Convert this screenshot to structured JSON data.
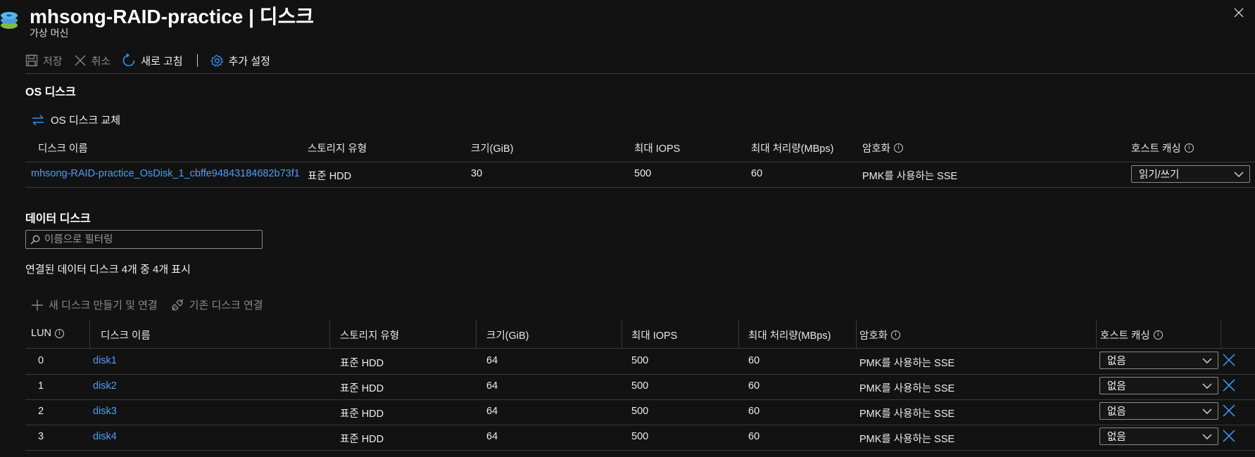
{
  "header": {
    "title": "mhsong-RAID-practice | 디스크",
    "subtitle": "가상 머신"
  },
  "toolbar": {
    "save_label": "저장",
    "discard_label": "취소",
    "refresh_label": "새로 고침",
    "settings_label": "추가 설정"
  },
  "os_disk": {
    "section_title": "OS 디스크",
    "swap_label": "OS 디스크 교체",
    "columns": {
      "name": "디스크 이름",
      "storage": "스토리지 유형",
      "size": "크기(GiB)",
      "iops": "최대 IOPS",
      "throughput": "최대 처리량(MBps)",
      "encryption": "암호화",
      "caching": "호스트 캐싱"
    },
    "row": {
      "name": "mhsong-RAID-practice_OsDisk_1_cbffe94843184682b73f1",
      "storage": "표준 HDD",
      "size": "30",
      "iops": "500",
      "throughput": "60",
      "encryption": "PMK를 사용하는 SSE",
      "caching": "읽기/쓰기"
    }
  },
  "data_disks": {
    "section_title": "데이터 디스크",
    "filter_placeholder": "이름으로 필터링",
    "count_text": "연결된 데이터 디스크 4개 중 4개 표시",
    "create_label": "새 디스크 만들기 및 연결",
    "attach_label": "기존 디스크 연결",
    "columns": {
      "lun": "LUN",
      "name": "디스크 이름",
      "storage": "스토리지 유형",
      "size": "크기(GiB)",
      "iops": "최대 IOPS",
      "throughput": "최대 처리량(MBps)",
      "encryption": "암호화",
      "caching": "호스트 캐싱"
    },
    "rows": [
      {
        "lun": "0",
        "name": "disk1",
        "storage": "표준 HDD",
        "size": "64",
        "iops": "500",
        "throughput": "60",
        "encryption": "PMK를 사용하는 SSE",
        "caching": "없음"
      },
      {
        "lun": "1",
        "name": "disk2",
        "storage": "표준 HDD",
        "size": "64",
        "iops": "500",
        "throughput": "60",
        "encryption": "PMK를 사용하는 SSE",
        "caching": "없음"
      },
      {
        "lun": "2",
        "name": "disk3",
        "storage": "표준 HDD",
        "size": "64",
        "iops": "500",
        "throughput": "60",
        "encryption": "PMK를 사용하는 SSE",
        "caching": "없음"
      },
      {
        "lun": "3",
        "name": "disk4",
        "storage": "표준 HDD",
        "size": "64",
        "iops": "500",
        "throughput": "60",
        "encryption": "PMK를 사용하는 SSE",
        "caching": "없음"
      }
    ]
  },
  "icons": {
    "header": "disk-stack-icon",
    "save": "save-icon",
    "discard": "close-icon",
    "refresh": "refresh-icon",
    "settings": "gear-icon",
    "swap": "swap-icon",
    "filter": "search-icon",
    "create": "plus-icon",
    "attach": "plug-icon",
    "delete": "delete-x-icon",
    "info": "info-icon",
    "dropdown": "chevron-down-icon"
  },
  "colors": {
    "background": "#121212",
    "link": "#4f9df7",
    "accent": "#3b8eea",
    "text": "#f2f2f2",
    "disabled": "#8a8a8a"
  }
}
